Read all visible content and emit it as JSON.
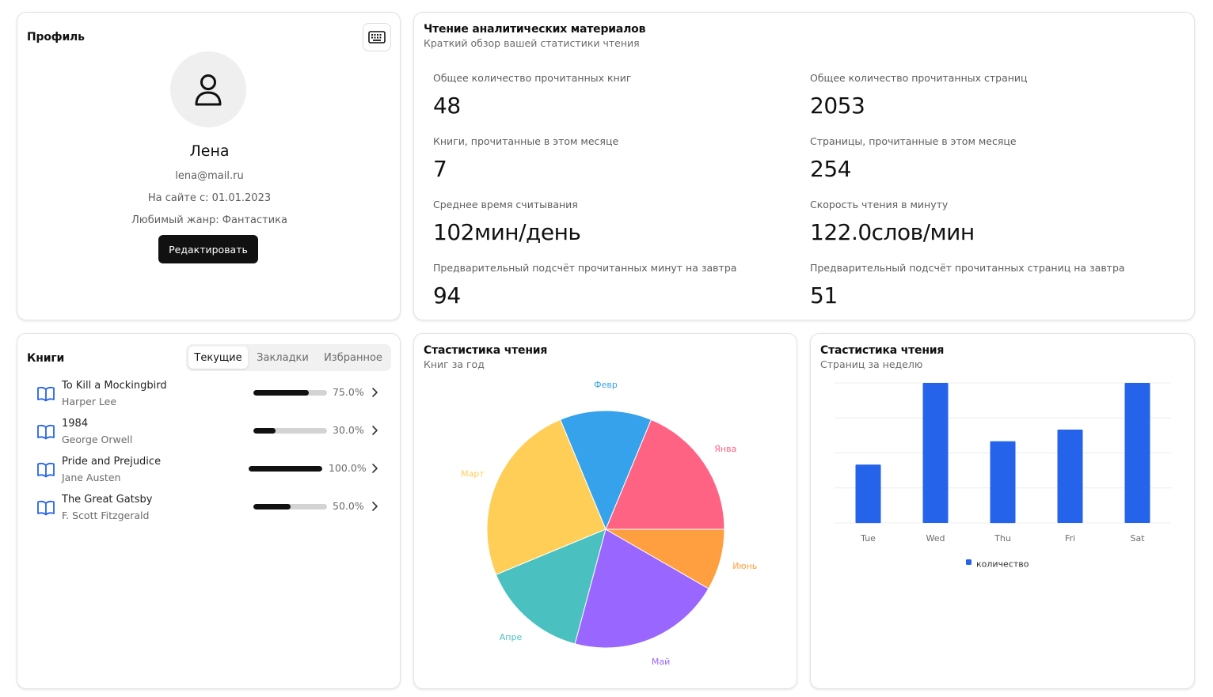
{
  "profile": {
    "title": "Профиль",
    "name": "Лена",
    "email": "lena@mail.ru",
    "since": "На сайте с: 01.01.2023",
    "genre": "Любимый жанр: Фантастика",
    "edit_label": "Редактировать"
  },
  "analytics": {
    "title": "Чтение аналитических материалов",
    "subtitle": "Краткий обзор вашей статистики чтения",
    "stats": [
      {
        "label": "Общее количество прочитанных книг",
        "value": "48"
      },
      {
        "label": "Общее количество прочитанных страниц",
        "value": "2053"
      },
      {
        "label": "Книги, прочитанные в этом месяце",
        "value": "7"
      },
      {
        "label": "Страницы, прочитанные в этом месяце",
        "value": "254"
      },
      {
        "label": "Среднее время считывания",
        "value": "102мин/день"
      },
      {
        "label": "Скорость чтения в минуту",
        "value": "122.0слов/мин"
      },
      {
        "label": "Предварительный подсчёт прочитанных минут на завтра",
        "value": "94"
      },
      {
        "label": "Предварительный подсчёт прочитанных страниц на завтра",
        "value": "51"
      }
    ]
  },
  "books": {
    "title": "Книги",
    "tabs": [
      {
        "label": "Текущие",
        "active": true
      },
      {
        "label": "Закладки",
        "active": false
      },
      {
        "label": "Избранное",
        "active": false
      }
    ],
    "items": [
      {
        "title": "To Kill a Mockingbird",
        "author": "Harper Lee",
        "progress": 75.0,
        "progress_label": "75.0%"
      },
      {
        "title": "1984",
        "author": "George Orwell",
        "progress": 30.0,
        "progress_label": "30.0%"
      },
      {
        "title": "Pride and Prejudice",
        "author": "Jane Austen",
        "progress": 100.0,
        "progress_label": "100.0%"
      },
      {
        "title": "The Great Gatsby",
        "author": "F. Scott Fitzgerald",
        "progress": 50.0,
        "progress_label": "50.0%"
      }
    ]
  },
  "pie_card": {
    "title": "Стастистика чтения",
    "subtitle": "Книг за год"
  },
  "bar_card": {
    "title": "Стастистика чтения",
    "subtitle": "Страниц за неделю"
  },
  "chart_data": [
    {
      "type": "pie",
      "categories": [
        "Янва",
        "Февр",
        "Март",
        "Апре",
        "Май",
        "Июнь"
      ],
      "values": [
        9,
        6,
        12,
        7,
        10,
        4
      ],
      "colors": [
        "#ff6384",
        "#36a2eb",
        "#ffce56",
        "#4bc0c0",
        "#9966ff",
        "#ff9f40"
      ]
    },
    {
      "type": "bar",
      "categories": [
        "Tue",
        "Wed",
        "Thu",
        "Fri",
        "Sat"
      ],
      "series": [
        {
          "name": "количество",
          "values": [
            25,
            60,
            35,
            40,
            60
          ],
          "color": "#2563eb"
        }
      ],
      "ylim": [
        0,
        60
      ],
      "grid": true,
      "legend": "bottom"
    }
  ]
}
